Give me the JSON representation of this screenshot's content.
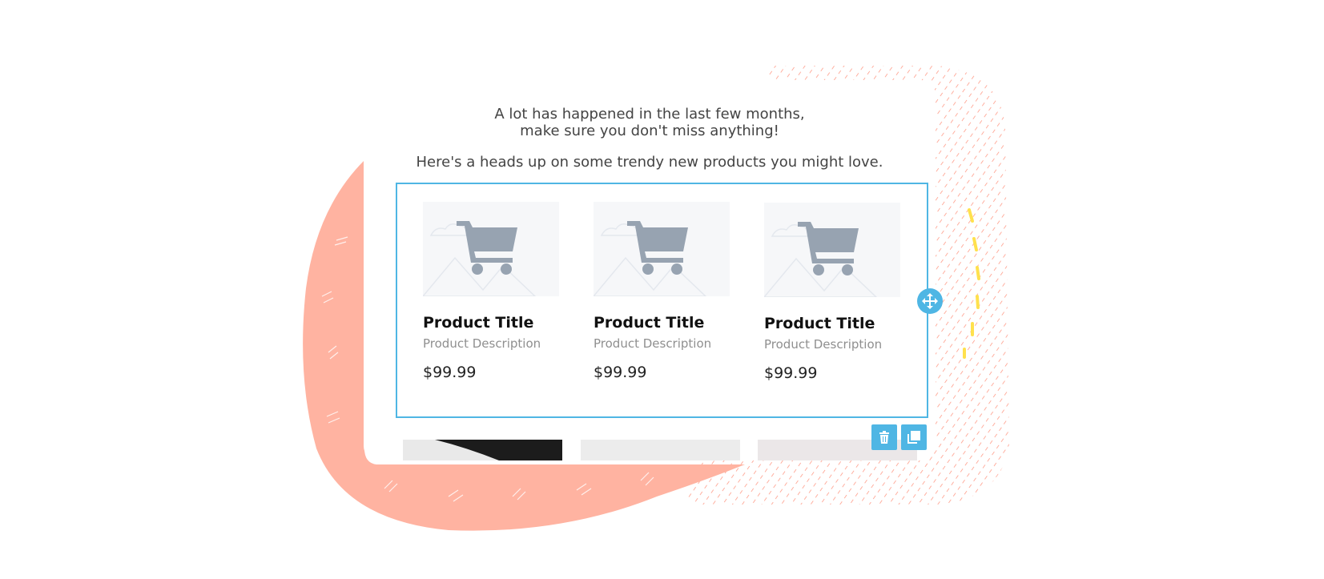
{
  "intro": {
    "line1": "A lot has happened in the last few months,",
    "line2": "make sure you don't miss anything!",
    "line3": "Here's a heads up on some trendy new products you might love."
  },
  "products": [
    {
      "title": "Product Title",
      "description": "Product Description",
      "price": "$99.99",
      "icon": "shopping-cart-icon"
    },
    {
      "title": "Product Title",
      "description": "Product Description",
      "price": "$99.99",
      "icon": "shopping-cart-icon"
    },
    {
      "title": "Product Title",
      "description": "Product Description",
      "price": "$99.99",
      "icon": "shopping-cart-icon"
    }
  ],
  "toolbar": {
    "move_icon": "move-arrows-icon",
    "delete_icon": "trash-icon",
    "duplicate_icon": "duplicate-icon"
  },
  "colors": {
    "accent": "#4fb6e4",
    "decor_blob": "#ffb3a1",
    "decor_hatch": "#ff8a73",
    "decor_dash": "#ffe14d",
    "cart_icon": "#97a3b1"
  }
}
